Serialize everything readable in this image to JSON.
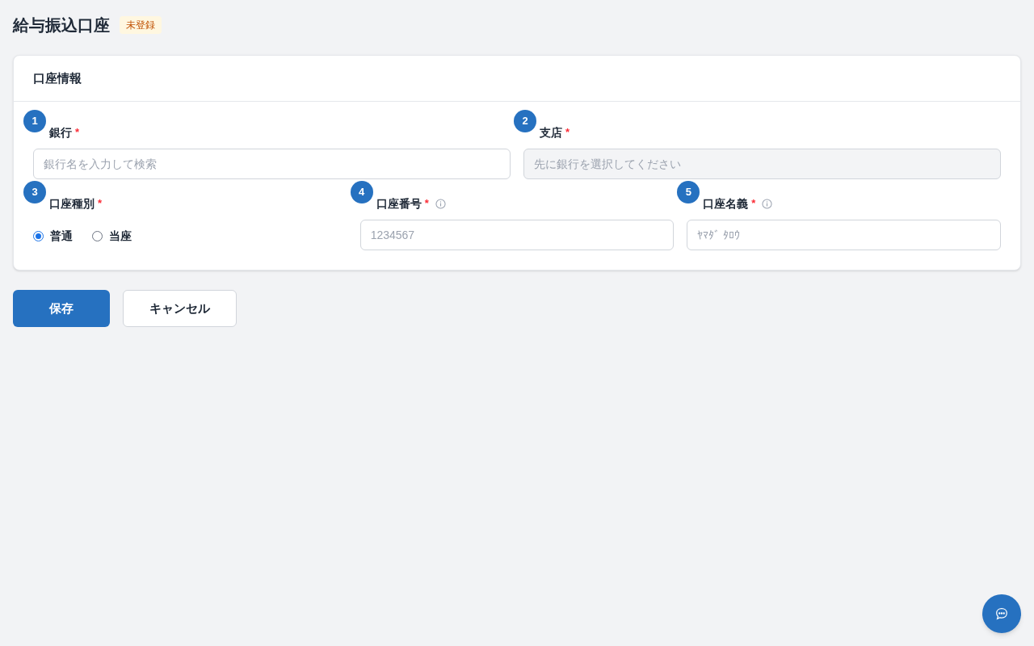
{
  "page": {
    "title": "給与振込口座",
    "status_badge": "未登録"
  },
  "card": {
    "title": "口座情報",
    "rows": [
      [
        {
          "kind": "text",
          "marker": "1",
          "label": "銀行",
          "required": "*",
          "disabled": false,
          "placeholder": "銀行名を入力して検索"
        },
        {
          "kind": "text",
          "marker": "2",
          "label": "支店",
          "required": "*",
          "disabled": true,
          "placeholder": "先に銀行を選択してください"
        }
      ],
      [
        {
          "kind": "radio",
          "marker": "3",
          "label": "口座種別",
          "required": "*",
          "options": [
            {
              "label": "普通",
              "selected": true
            },
            {
              "label": "当座",
              "selected": false
            }
          ]
        },
        {
          "kind": "text",
          "marker": "4",
          "label": "口座番号",
          "required": "*",
          "info": true,
          "disabled": false,
          "placeholder": "1234567"
        },
        {
          "kind": "text",
          "marker": "5",
          "label": "口座名義",
          "required": "*",
          "info": true,
          "disabled": false,
          "placeholder": "ﾔﾏﾀﾞ ﾀﾛｳ"
        }
      ]
    ]
  },
  "buttons": [
    {
      "kind": "primary",
      "label": "保存"
    },
    {
      "kind": "secondary",
      "label": "キャンセル"
    }
  ]
}
